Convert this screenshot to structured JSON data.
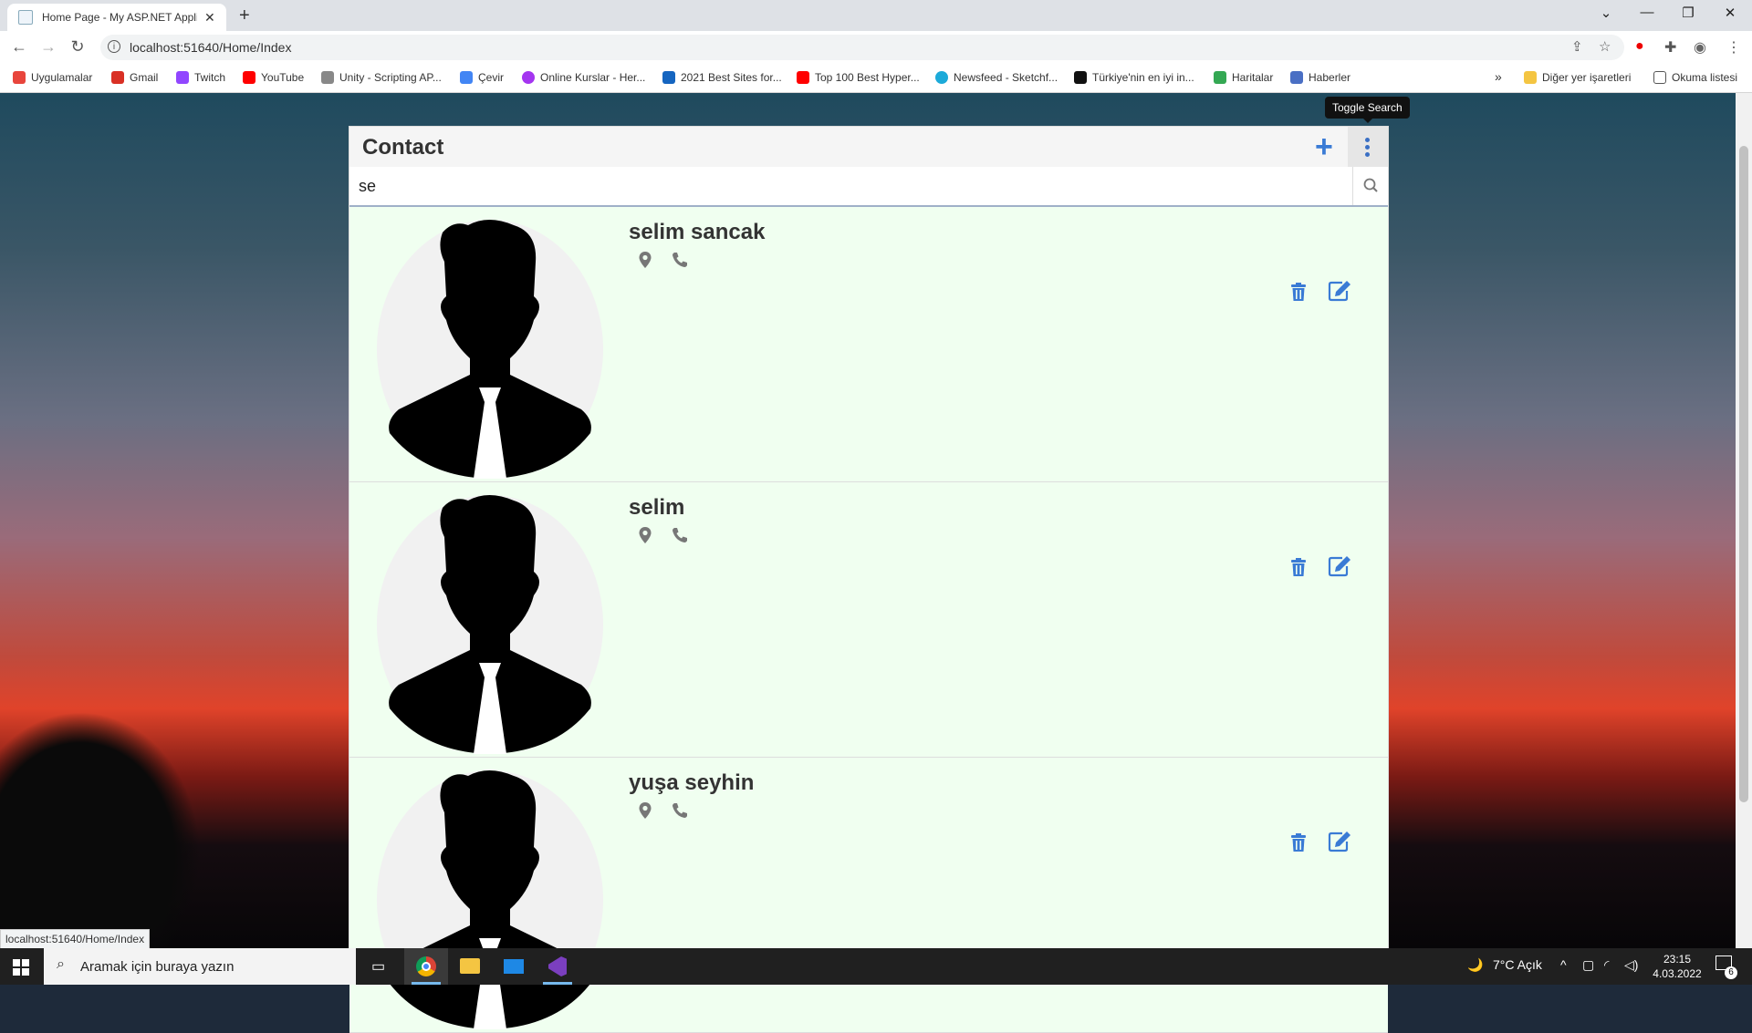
{
  "browser": {
    "tab_title": "Home Page - My ASP.NET Applic",
    "url": "localhost:51640/Home/Index",
    "bookmarks": [
      {
        "label": "Uygulamalar",
        "icon": "apps-grid-icon",
        "color": "#e8453c"
      },
      {
        "label": "Gmail",
        "icon": "gmail-icon",
        "color": "#d93025"
      },
      {
        "label": "Twitch",
        "icon": "twitch-icon",
        "color": "#9146ff"
      },
      {
        "label": "YouTube",
        "icon": "youtube-icon",
        "color": "#ff0000"
      },
      {
        "label": "Unity - Scripting AP...",
        "icon": "unity-icon",
        "color": "#555555"
      },
      {
        "label": "Çevir",
        "icon": "translate-icon",
        "color": "#4285f4"
      },
      {
        "label": "Online Kurslar - Her...",
        "icon": "udemy-icon",
        "color": "#a435f0"
      },
      {
        "label": "2021 Best Sites for...",
        "icon": "3d-icon",
        "color": "#1565c0"
      },
      {
        "label": "Top 100 Best Hyper...",
        "icon": "youtube-icon",
        "color": "#ff0000"
      },
      {
        "label": "Newsfeed - Sketchf...",
        "icon": "sketchfab-icon",
        "color": "#1caad9"
      },
      {
        "label": "Türkiye'nin en iyi in...",
        "icon": "wave-icon",
        "color": "#111111"
      },
      {
        "label": "Haritalar",
        "icon": "maps-icon",
        "color": "#34a853"
      },
      {
        "label": "Haberler",
        "icon": "news-icon",
        "color": "#4a6fc4"
      }
    ],
    "overflow_label": "»",
    "other_bookmarks": "Diğer yer işaretleri",
    "reading_list": "Okuma listesi",
    "status_url": "localhost:51640/Home/Index"
  },
  "app": {
    "title": "Contact",
    "tooltip": "Toggle Search",
    "search_value": "se",
    "accent_color": "#3a7bd5",
    "contacts": [
      {
        "name": "selim sancak"
      },
      {
        "name": "selim"
      },
      {
        "name": "yuşa seyhin"
      }
    ]
  },
  "taskbar": {
    "search_placeholder": "Aramak için buraya yazın",
    "weather": "7°C  Açık",
    "time": "23:15",
    "date": "4.03.2022",
    "notification_count": "6"
  }
}
